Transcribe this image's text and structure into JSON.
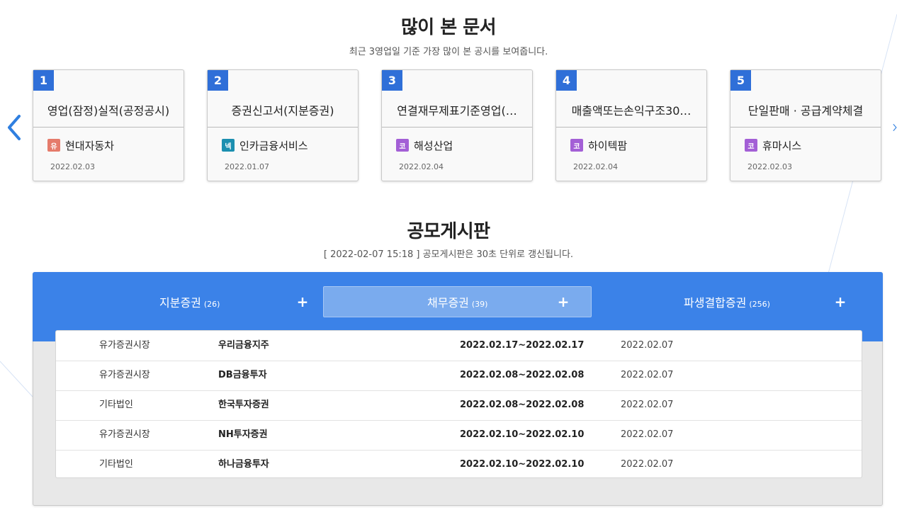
{
  "popular": {
    "title": "많이 본 문서",
    "subtitle": "최근 3영업일 기준 가장 많이 본 공시를 보여줍니다.",
    "cards": [
      {
        "rank": "1",
        "title": "영업(잠정)실적(공정공시)",
        "badge": "유",
        "badge_color": "#e57b6b",
        "company": "현대자동차",
        "date": "2022.02.03"
      },
      {
        "rank": "2",
        "title": "증권신고서(지분증권)",
        "badge": "넥",
        "badge_color": "#1b8fb0",
        "company": "인카금융서비스",
        "date": "2022.01.07"
      },
      {
        "rank": "3",
        "title": "연결재무제표기준영업(…",
        "badge": "코",
        "badge_color": "#a35fd6",
        "company": "해성산업",
        "date": "2022.02.04"
      },
      {
        "rank": "4",
        "title": "매출액또는손익구조30…",
        "badge": "코",
        "badge_color": "#a35fd6",
        "company": "하이텍팜",
        "date": "2022.02.04"
      },
      {
        "rank": "5",
        "title": "단일판매 · 공급계약체결",
        "badge": "코",
        "badge_color": "#a35fd6",
        "company": "휴마시스",
        "date": "2022.02.03"
      }
    ]
  },
  "board": {
    "title": "공모게시판",
    "subtitle": "[ 2022-02-07 15:18 ] 공모게시판은 30초 단위로 갱신됩니다.",
    "tabs": [
      {
        "label": "지분증권",
        "count": "(26)",
        "plus": "+",
        "active": false
      },
      {
        "label": "채무증권",
        "count": "(39)",
        "plus": "+",
        "active": true
      },
      {
        "label": "파생결합증권",
        "count": "(256)",
        "plus": "+",
        "active": false
      }
    ],
    "rows": [
      {
        "market": "유가증권시장",
        "name": "우리금융지주",
        "period": "2022.02.17~2022.02.17",
        "posted": "2022.02.07"
      },
      {
        "market": "유가증권시장",
        "name": "DB금융투자",
        "period": "2022.02.08~2022.02.08",
        "posted": "2022.02.07"
      },
      {
        "market": "기타법인",
        "name": "한국투자증권",
        "period": "2022.02.08~2022.02.08",
        "posted": "2022.02.07"
      },
      {
        "market": "유가증권시장",
        "name": "NH투자증권",
        "period": "2022.02.10~2022.02.10",
        "posted": "2022.02.07"
      },
      {
        "market": "기타법인",
        "name": "하나금융투자",
        "period": "2022.02.10~2022.02.10",
        "posted": "2022.02.07"
      }
    ]
  },
  "colors": {
    "accent": "#3b82e8",
    "rank_bg": "#2f6fd8",
    "active_tab": "#7aabee",
    "arrow": "#2f7fe0"
  },
  "icons": {
    "prev": "chevron-left-icon",
    "next": "chevron-right-icon"
  }
}
